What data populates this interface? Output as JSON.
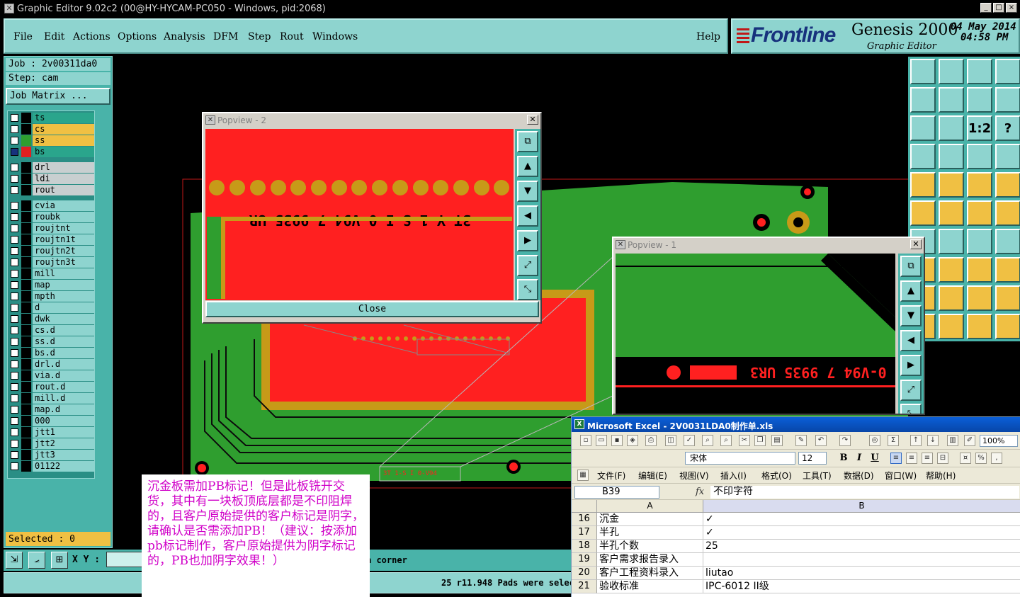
{
  "window": {
    "title": "Graphic Editor 9.02c2 (00@HY-HYCAM-PC050 - Windows, pid:2068)",
    "controls": [
      "_",
      "□",
      "×"
    ]
  },
  "menu": {
    "items": [
      "File",
      "Edit",
      "Actions",
      "Options",
      "Analysis",
      "DFM",
      "Step",
      "Rout",
      "Windows"
    ],
    "help": "Help"
  },
  "brand": {
    "logo": "Frontline",
    "product": "Genesis 2000",
    "subtitle": "Graphic Editor",
    "date": "04 May 2014",
    "time": "04:58 PM"
  },
  "job": {
    "job_label": "Job : 2v00311da0",
    "step_label": "Step: cam",
    "matrix_button": "Job Matrix ..."
  },
  "layers": [
    {
      "name": "ts",
      "color": "#2aa58c",
      "swatch": "#000000",
      "group": 0
    },
    {
      "name": "cs",
      "color": "#f0c043",
      "swatch": "#000000",
      "group": 0
    },
    {
      "name": "ss",
      "color": "#f0c043",
      "swatch": "#2f9e2f",
      "group": 0
    },
    {
      "name": "bs",
      "color": "#2aa58c",
      "swatch": "#e02020",
      "group": 0,
      "checked": true
    },
    {
      "name": "drl",
      "color": "#c8cfd0",
      "swatch": "#000000",
      "group": 1
    },
    {
      "name": "ldi",
      "color": "#c8cfd0",
      "swatch": "#000000",
      "group": 1
    },
    {
      "name": "rout",
      "color": "#c8cfd0",
      "swatch": "#000000",
      "group": 1
    },
    {
      "name": "cvia",
      "color": "#8ed4cf",
      "swatch": "#000000",
      "group": 2
    },
    {
      "name": "roubk",
      "color": "#8ed4cf",
      "swatch": "#000000",
      "group": 2
    },
    {
      "name": "roujtnt",
      "color": "#8ed4cf",
      "swatch": "#000000",
      "group": 2
    },
    {
      "name": "roujtn1t",
      "color": "#8ed4cf",
      "swatch": "#000000",
      "group": 2
    },
    {
      "name": "roujtn2t",
      "color": "#8ed4cf",
      "swatch": "#000000",
      "group": 2
    },
    {
      "name": "roujtn3t",
      "color": "#8ed4cf",
      "swatch": "#000000",
      "group": 2
    },
    {
      "name": "mill",
      "color": "#8ed4cf",
      "swatch": "#000000",
      "group": 2
    },
    {
      "name": "map",
      "color": "#8ed4cf",
      "swatch": "#000000",
      "group": 2
    },
    {
      "name": "mpth",
      "color": "#8ed4cf",
      "swatch": "#000000",
      "group": 2
    },
    {
      "name": "d",
      "color": "#8ed4cf",
      "swatch": "#000000",
      "group": 2
    },
    {
      "name": "dwk",
      "color": "#8ed4cf",
      "swatch": "#000000",
      "group": 2
    },
    {
      "name": "cs.d",
      "color": "#8ed4cf",
      "swatch": "#000000",
      "group": 2
    },
    {
      "name": "ss.d",
      "color": "#8ed4cf",
      "swatch": "#000000",
      "group": 2
    },
    {
      "name": "bs.d",
      "color": "#8ed4cf",
      "swatch": "#000000",
      "group": 2
    },
    {
      "name": "drl.d",
      "color": "#8ed4cf",
      "swatch": "#000000",
      "group": 2
    },
    {
      "name": "via.d",
      "color": "#8ed4cf",
      "swatch": "#000000",
      "group": 2
    },
    {
      "name": "rout.d",
      "color": "#8ed4cf",
      "swatch": "#000000",
      "group": 2
    },
    {
      "name": "mill.d",
      "color": "#8ed4cf",
      "swatch": "#000000",
      "group": 2
    },
    {
      "name": "map.d",
      "color": "#8ed4cf",
      "swatch": "#000000",
      "group": 2
    },
    {
      "name": "000",
      "color": "#8ed4cf",
      "swatch": "#000000",
      "group": 2
    },
    {
      "name": "jtt1",
      "color": "#8ed4cf",
      "swatch": "#000000",
      "group": 2
    },
    {
      "name": "jtt2",
      "color": "#8ed4cf",
      "swatch": "#000000",
      "group": 2
    },
    {
      "name": "jtt3",
      "color": "#8ed4cf",
      "swatch": "#000000",
      "group": 2
    },
    {
      "name": "01122",
      "color": "#8ed4cf",
      "swatch": "#000000",
      "group": 2
    }
  ],
  "selected": "Selected : 0",
  "status": {
    "xy_label": "X Y :",
    "xy_value": "",
    "hint": "a corner",
    "message": "25 r11.948 Pads were selec"
  },
  "tools": {
    "icons": [
      "layer-up-icon",
      "layer-down-icon",
      "home-icon",
      "window-icon",
      "pan-left-icon",
      "pan-right-icon",
      "undo-view-icon",
      "redraw-icon",
      "zoom-fit-icon",
      "zoom-center-icon",
      "zoom-1to1-icon",
      "help-icon",
      "measure-icon",
      "snap-icon",
      "net-red-icon",
      "net-red-2-icon",
      "select-icon",
      "draw-icon",
      "ruler-icon",
      "circle-icon",
      "connect-icon",
      "cross-icon",
      "node-icon",
      "node-2-icon",
      "line-icon",
      "arc-icon",
      "rotate-icon",
      "mirror-icon",
      "cut-icon",
      "stretch-icon",
      "contour-icon",
      "group-icon",
      "triangle-icon",
      "triangle-2-icon",
      "triangle-3-icon",
      "triangle-4-icon",
      "pointer-icon",
      "pointer-2-icon",
      "pointer-3-icon",
      "step-icon"
    ],
    "labels": [
      "",
      "",
      "",
      "",
      "",
      "",
      "",
      "",
      "",
      "",
      "1:2",
      "?",
      "",
      "",
      "",
      "",
      "",
      "",
      "",
      "",
      "",
      "",
      "",
      "",
      "",
      "",
      "",
      "",
      "",
      "",
      "",
      "",
      "",
      "",
      "",
      "",
      "",
      "",
      "",
      ""
    ]
  },
  "popview2": {
    "title": "Popview - 2",
    "marking": "3T Y 1-S I 0-V94 7 9935 UR",
    "close_label": "Close",
    "side_icons": [
      "snapshot-icon",
      "pan-up-icon",
      "pan-down-icon",
      "pan-left-icon",
      "pan-right-icon",
      "zoom-in-icon",
      "zoom-out-icon"
    ]
  },
  "popview1": {
    "title": "Popview - 1",
    "marking": "0-V94 7 9935 UR3",
    "side_icons": [
      "snapshot-icon",
      "pan-up-icon",
      "pan-down-icon",
      "pan-left-icon",
      "pan-right-icon",
      "zoom-in-icon",
      "zoom-out-icon"
    ]
  },
  "board": {
    "small_marking": "3T 1-S I 0-V94"
  },
  "note": {
    "text": "沉金板需加PB标记！但是此板铣开交货，其中有一块板顶底层都是不印阻焊的，且客户原始提供的客户标记是阴字，请确认是否需添加PB！（建议：按添加pb标记制作，客户原始提供为阴字标记的，PB也加阴字效果！）"
  },
  "excel": {
    "title": "Microsoft Excel - 2V0031LDA0制作单.xls",
    "font": "宋体",
    "size": "12",
    "zoom": "100%",
    "menus": [
      "文件(F)",
      "编辑(E)",
      "视图(V)",
      "插入(I)",
      "格式(O)",
      "工具(T)",
      "数据(D)",
      "窗口(W)",
      "帮助(H)"
    ],
    "name_box": "B39",
    "fx": "fx",
    "formula": "不印字符",
    "columns": [
      "A",
      "B"
    ],
    "rows": [
      {
        "n": "16",
        "a": "沉金",
        "b": "✓"
      },
      {
        "n": "17",
        "a": "半孔",
        "b": "✓"
      },
      {
        "n": "18",
        "a": "半孔个数",
        "b": "25"
      },
      {
        "n": "19",
        "a": "客户需求报告录入",
        "b": ""
      },
      {
        "n": "20",
        "a": "客户工程资料录入",
        "b": "liutao"
      },
      {
        "n": "21",
        "a": "验收标准",
        "b": "IPC-6012 II级"
      }
    ]
  }
}
